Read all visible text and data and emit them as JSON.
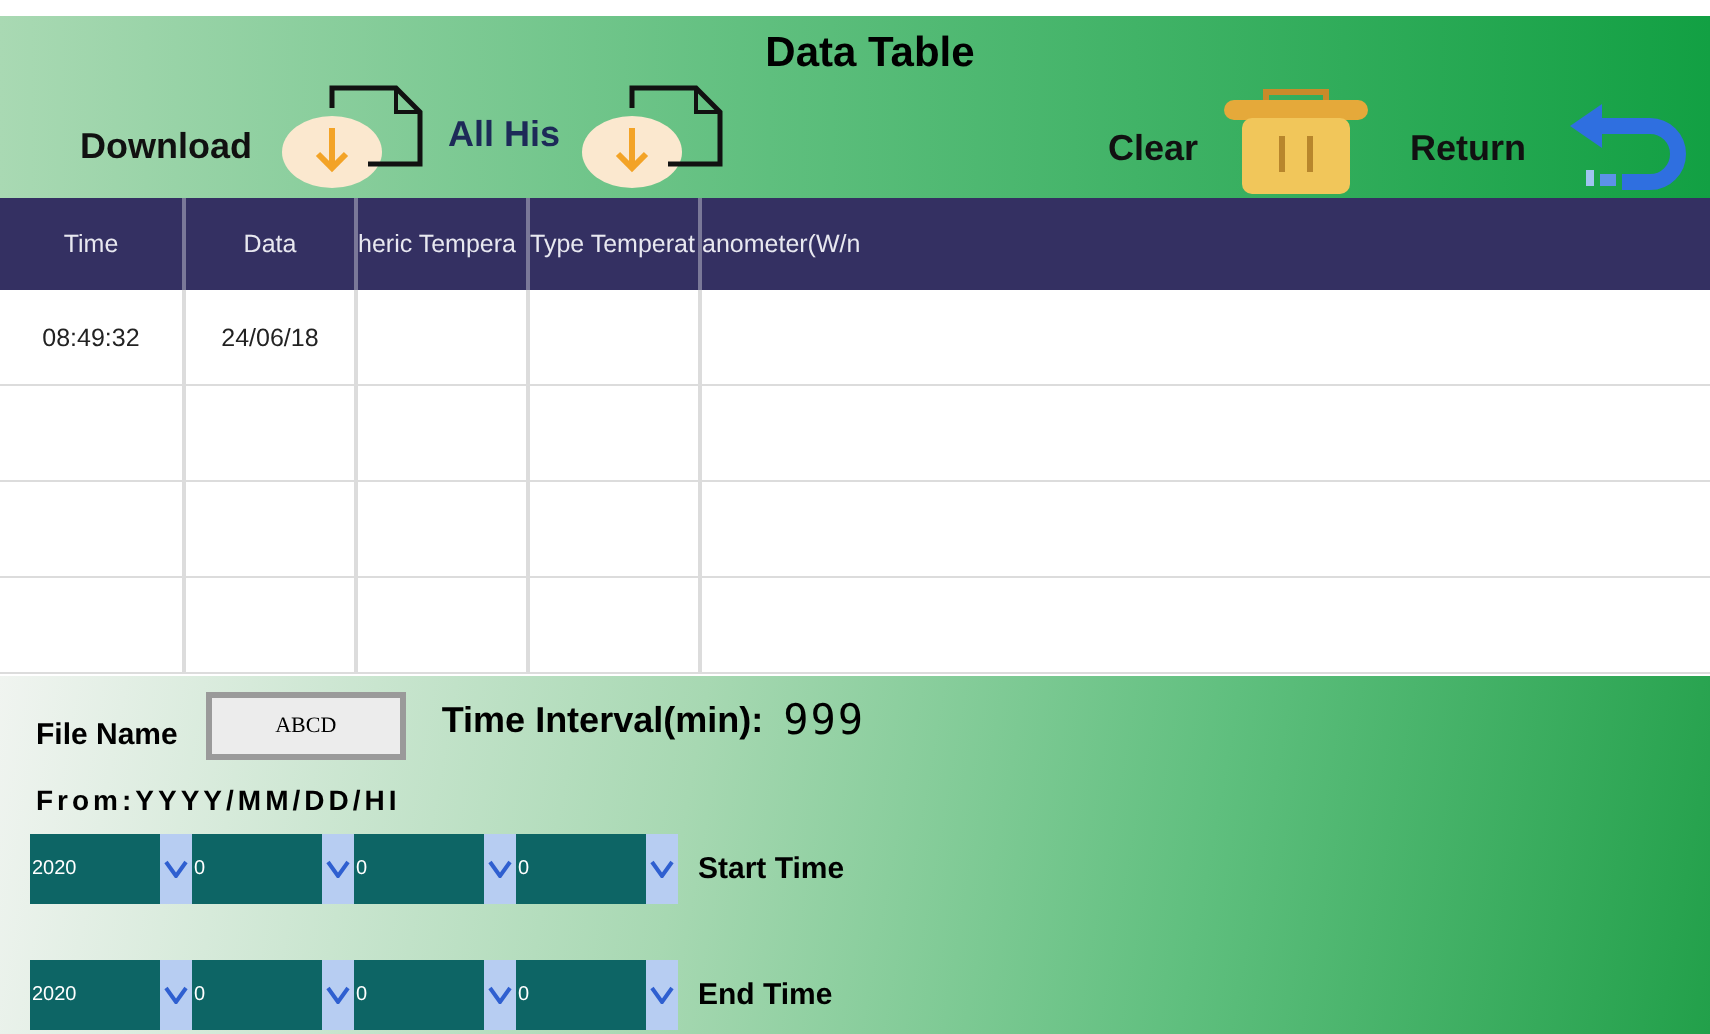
{
  "header": {
    "title": "Data Table",
    "download_label": "Download",
    "all_history_label": "All His",
    "clear_label": "Clear",
    "return_label": "Return"
  },
  "table": {
    "columns": [
      "Time",
      "Data",
      "heric Tempera",
      "Type Temperat",
      "anometer(W/n"
    ],
    "rows": [
      {
        "cells": [
          "08:49:32",
          "24/06/18"
        ]
      }
    ]
  },
  "settings": {
    "file_name_label": "File Name",
    "file_name": "ABCD",
    "interval_label": "Time Interval(min):",
    "interval_value": "999",
    "from_label": "From:YYYY/MM/DD/HI",
    "ranges": [
      {
        "label": "Start Time",
        "values": [
          "2020",
          "0",
          "0",
          "0"
        ]
      },
      {
        "label": "End Time",
        "values": [
          "2020",
          "0",
          "0",
          "0"
        ]
      }
    ]
  }
}
